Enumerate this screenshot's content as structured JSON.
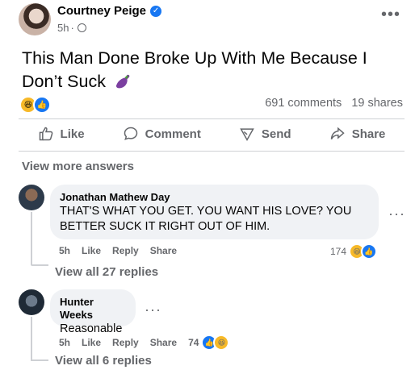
{
  "post": {
    "author": "Courtney Peige",
    "time": "5h",
    "dot": "·",
    "text": "This Man Done Broke Up With Me Because I Don’t Suck",
    "comments_count": "691 comments",
    "shares_count": "19 shares"
  },
  "actions": {
    "like": "Like",
    "comment": "Comment",
    "send": "Send",
    "share": "Share"
  },
  "view_more": "View more answers",
  "comments": [
    {
      "author": "Jonathan Mathew Day",
      "text": "THAT'S WHAT YOU GET. YOU WANT HIS LOVE? YOU BETTER SUCK IT RIGHT OUT OF HIM.",
      "time": "5h",
      "like": "Like",
      "reply": "Reply",
      "share": "Share",
      "reactions": "174",
      "view_replies": "View all 27 replies"
    },
    {
      "author": "Hunter Weeks",
      "text": "Reasonable",
      "time": "5h",
      "like": "Like",
      "reply": "Reply",
      "share": "Share",
      "reactions": "74",
      "view_replies": "View all 6 replies"
    }
  ],
  "icons": {
    "more": "more-dots-icon",
    "verified": "verified-badge-icon",
    "globe": "globe-icon",
    "haha": "haha-reaction-icon",
    "like": "like-reaction-icon",
    "eggplant": "eggplant-emoji-icon"
  },
  "colors": {
    "primary_text": "#050505",
    "secondary_text": "#65676b",
    "facebook_blue": "#1877f2",
    "bubble_bg": "#f0f2f5",
    "haha_yellow": "#f7b928"
  }
}
